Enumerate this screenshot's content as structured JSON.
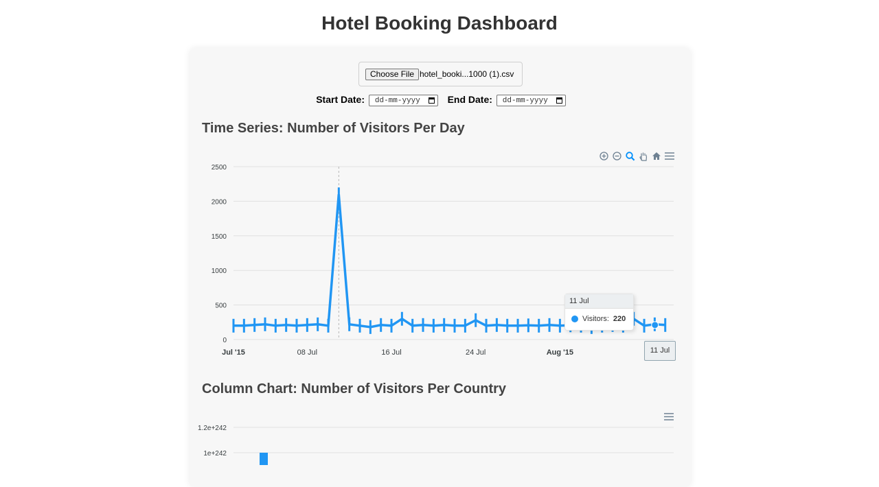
{
  "page_title": "Hotel Booking Dashboard",
  "file_input": {
    "button_label": "Choose File",
    "file_name": "hotel_booki...1000 (1).csv"
  },
  "filters": {
    "start_label": "Start Date:",
    "start_placeholder": "dd-mm-yyyy",
    "end_label": "End Date:",
    "end_placeholder": "dd-mm-yyyy"
  },
  "chart1": {
    "title": "Time Series: Number of Visitors Per Day",
    "toolbar": [
      "zoom-in-icon",
      "zoom-out-icon",
      "magnifier-icon",
      "pan-hand-icon",
      "home-icon",
      "menu-icon"
    ],
    "tooltip": {
      "date": "11 Jul",
      "series": "Visitors:",
      "value": "220"
    },
    "crosshair_label": "11 Jul"
  },
  "chart2": {
    "title": "Column Chart: Number of Visitors Per Country",
    "toolbar": [
      "menu-icon"
    ]
  },
  "colors": {
    "series": "#2196f3",
    "grid": "#e0e0e0",
    "axis_text": "#373d3f"
  },
  "chart_data": [
    {
      "type": "line",
      "title": "Time Series: Number of Visitors Per Day",
      "x_axis": "date",
      "x_tick_labels": [
        "Jul '15",
        "08 Jul",
        "16 Jul",
        "24 Jul",
        "Aug '15",
        "11 Jul"
      ],
      "ylim": [
        0,
        2500
      ],
      "y_ticks": [
        0,
        500,
        1000,
        1500,
        2000,
        2500
      ],
      "series": [
        {
          "name": "Visitors",
          "x": [
            "2015-07-01",
            "2015-07-02",
            "2015-07-03",
            "2015-07-04",
            "2015-07-05",
            "2015-07-06",
            "2015-07-07",
            "2015-07-08",
            "2015-07-09",
            "2015-07-10",
            "2015-07-11",
            "2015-07-12",
            "2015-07-13",
            "2015-07-14",
            "2015-07-15",
            "2015-07-16",
            "2015-07-17",
            "2015-07-18",
            "2015-07-19",
            "2015-07-20",
            "2015-07-21",
            "2015-07-22",
            "2015-07-23",
            "2015-07-24",
            "2015-07-25",
            "2015-07-26",
            "2015-07-27",
            "2015-07-28",
            "2015-07-29",
            "2015-07-30",
            "2015-07-31",
            "2015-08-01",
            "2015-08-02",
            "2015-08-03",
            "2015-08-04",
            "2015-08-05",
            "2015-08-06",
            "2015-08-07",
            "2015-08-08",
            "2015-08-09",
            "2015-08-10",
            "2015-08-11"
          ],
          "values": [
            200,
            200,
            210,
            220,
            200,
            210,
            200,
            210,
            220,
            200,
            2100,
            220,
            200,
            180,
            210,
            200,
            300,
            200,
            210,
            200,
            210,
            200,
            200,
            280,
            200,
            210,
            200,
            200,
            205,
            200,
            210,
            200,
            205,
            200,
            180,
            200,
            210,
            200,
            300,
            200,
            220,
            210
          ]
        }
      ]
    },
    {
      "type": "bar",
      "title": "Column Chart: Number of Visitors Per Country",
      "y_tick_labels": [
        "1.2e+242",
        "1e+242"
      ],
      "ylim": [
        0,
        1.2e+242
      ],
      "series": [
        {
          "values": [
            1e+242
          ]
        }
      ]
    }
  ]
}
